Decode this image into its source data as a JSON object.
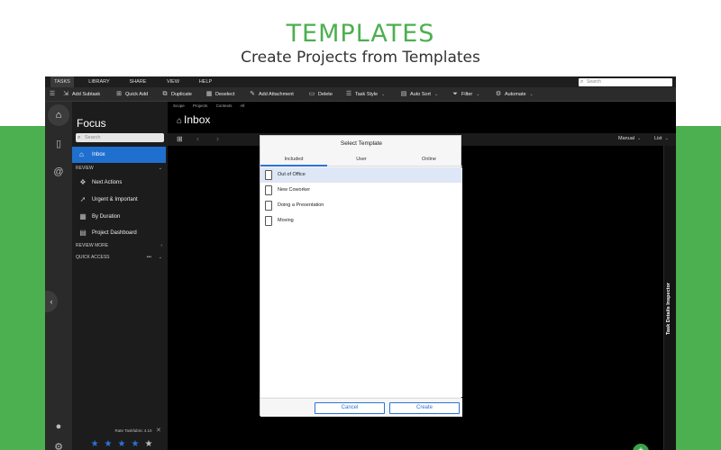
{
  "banner": {
    "title": "TEMPLATES",
    "subtitle": "Create Projects from Templates"
  },
  "menubar": {
    "menus": [
      "TASKS",
      "LIBRARY",
      "SHARE",
      "VIEW",
      "HELP"
    ],
    "active": "TASKS",
    "search_placeholder": "Search"
  },
  "toolbar": {
    "add_subtask": "Add Subtask",
    "quick_add": "Quick Add",
    "duplicate": "Duplicate",
    "deselect": "Deselect",
    "add_attachment": "Add Attachment",
    "delete": "Delete",
    "task_style": "Task Style",
    "auto_sort": "Auto Sort",
    "filter": "Filter",
    "automate": "Automate"
  },
  "sidebar": {
    "heading": "Focus",
    "search_placeholder": "Search",
    "inbox_label": "Inbox",
    "review_section": "REVIEW",
    "items": [
      {
        "label": "Next Actions",
        "icon": "layers-icon"
      },
      {
        "label": "Urgent & Important",
        "icon": "rocket-icon"
      },
      {
        "label": "By Duration",
        "icon": "calendar-icon"
      },
      {
        "label": "Project Dashboard",
        "icon": "dashboard-icon"
      }
    ],
    "review_more": "REVIEW MORE",
    "quick_access": "QUICK ACCESS",
    "rate_text": "Rate Taskfabric 4.10",
    "stars_filled": 4,
    "stars_total": 5
  },
  "main": {
    "breadcrumbs": [
      "Scope",
      "Projects",
      "Contexts",
      "All"
    ],
    "title": "Inbox",
    "sort_mode": "Manual",
    "view_mode": "List"
  },
  "inspector": {
    "label": "Task Details Inspector"
  },
  "dialog": {
    "title": "Select Template",
    "tabs": [
      "Included",
      "User",
      "Online"
    ],
    "active_tab": "Included",
    "templates": [
      "Out of Office",
      "New Coworker",
      "Doing a Presentation",
      "Moving"
    ],
    "selected": "Out of Office",
    "cancel_label": "Cancel",
    "create_label": "Create"
  },
  "colors": {
    "brand_green": "#4caf50",
    "accent_blue": "#2d73d6",
    "selection_blue": "#1f6fcf"
  }
}
